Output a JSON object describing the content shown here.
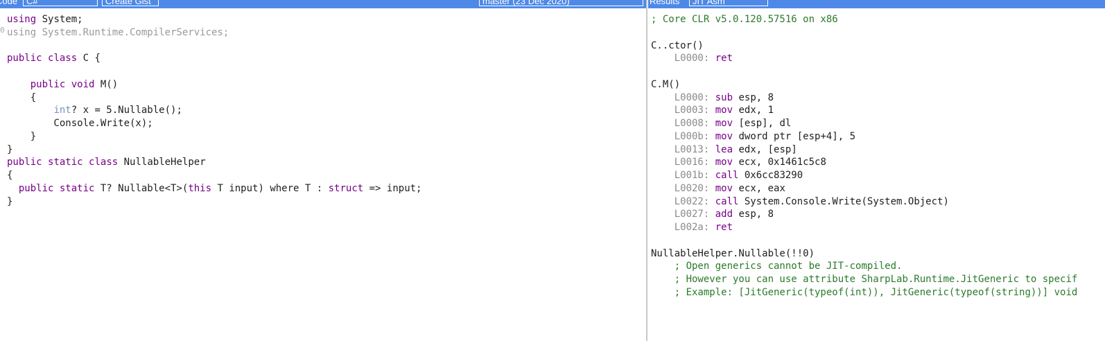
{
  "toolbar": {
    "code_label": "Code",
    "language": "C#",
    "create_gist": "Create Gist",
    "branch": "master (23 Dec 2020)",
    "results_label": "Results",
    "output_mode": "JIT Asm"
  },
  "code": {
    "gutter_mark": "0",
    "lines": [
      [
        [
          "kw",
          "using"
        ],
        [
          "plain",
          " System;"
        ]
      ],
      [
        [
          "faded",
          "using System.Runtime.CompilerServices;"
        ]
      ],
      [],
      [
        [
          "kw",
          "public"
        ],
        [
          "plain",
          " "
        ],
        [
          "kw",
          "class"
        ],
        [
          "plain",
          " C {"
        ]
      ],
      [],
      [
        [
          "plain",
          "    "
        ],
        [
          "kw",
          "public"
        ],
        [
          "plain",
          " "
        ],
        [
          "kw",
          "void"
        ],
        [
          "plain",
          " M()"
        ]
      ],
      [
        [
          "plain",
          "    {"
        ]
      ],
      [
        [
          "plain",
          "        "
        ],
        [
          "type",
          "int"
        ],
        [
          "plain",
          "? x = 5.Nullable();"
        ]
      ],
      [
        [
          "plain",
          "        Console.Write(x);"
        ]
      ],
      [
        [
          "plain",
          "    }"
        ]
      ],
      [
        [
          "plain",
          "}"
        ]
      ],
      [
        [
          "kw",
          "public"
        ],
        [
          "plain",
          " "
        ],
        [
          "kw",
          "static"
        ],
        [
          "plain",
          " "
        ],
        [
          "kw",
          "class"
        ],
        [
          "plain",
          " NullableHelper"
        ]
      ],
      [
        [
          "plain",
          "{"
        ]
      ],
      [
        [
          "plain",
          "  "
        ],
        [
          "kw",
          "public"
        ],
        [
          "plain",
          " "
        ],
        [
          "kw",
          "static"
        ],
        [
          "plain",
          " T? Nullable<T>("
        ],
        [
          "kw",
          "this"
        ],
        [
          "plain",
          " T input) where T : "
        ],
        [
          "kw",
          "struct"
        ],
        [
          "plain",
          " => input;"
        ]
      ],
      [
        [
          "plain",
          "}"
        ]
      ]
    ]
  },
  "result": {
    "lines": [
      [
        [
          "comment",
          "; Core CLR v5.0.120.57516 on x86"
        ]
      ],
      [],
      [
        [
          "plain",
          "C..ctor()"
        ]
      ],
      [
        [
          "plain",
          "    "
        ],
        [
          "addr",
          "L0000:"
        ],
        [
          "plain",
          " "
        ],
        [
          "kw",
          "ret"
        ]
      ],
      [],
      [
        [
          "plain",
          "C.M()"
        ]
      ],
      [
        [
          "plain",
          "    "
        ],
        [
          "addr",
          "L0000:"
        ],
        [
          "plain",
          " "
        ],
        [
          "kw",
          "sub"
        ],
        [
          "plain",
          " esp, 8"
        ]
      ],
      [
        [
          "plain",
          "    "
        ],
        [
          "addr",
          "L0003:"
        ],
        [
          "plain",
          " "
        ],
        [
          "kw",
          "mov"
        ],
        [
          "plain",
          " edx, 1"
        ]
      ],
      [
        [
          "plain",
          "    "
        ],
        [
          "addr",
          "L0008:"
        ],
        [
          "plain",
          " "
        ],
        [
          "kw",
          "mov"
        ],
        [
          "plain",
          " [esp], dl"
        ]
      ],
      [
        [
          "plain",
          "    "
        ],
        [
          "addr",
          "L000b:"
        ],
        [
          "plain",
          " "
        ],
        [
          "kw",
          "mov"
        ],
        [
          "plain",
          " dword ptr [esp+4], 5"
        ]
      ],
      [
        [
          "plain",
          "    "
        ],
        [
          "addr",
          "L0013:"
        ],
        [
          "plain",
          " "
        ],
        [
          "kw",
          "lea"
        ],
        [
          "plain",
          " edx, [esp]"
        ]
      ],
      [
        [
          "plain",
          "    "
        ],
        [
          "addr",
          "L0016:"
        ],
        [
          "plain",
          " "
        ],
        [
          "kw",
          "mov"
        ],
        [
          "plain",
          " ecx, 0x1461c5c8"
        ]
      ],
      [
        [
          "plain",
          "    "
        ],
        [
          "addr",
          "L001b:"
        ],
        [
          "plain",
          " "
        ],
        [
          "kw",
          "call"
        ],
        [
          "plain",
          " 0x6cc83290"
        ]
      ],
      [
        [
          "plain",
          "    "
        ],
        [
          "addr",
          "L0020:"
        ],
        [
          "plain",
          " "
        ],
        [
          "kw",
          "mov"
        ],
        [
          "plain",
          " ecx, eax"
        ]
      ],
      [
        [
          "plain",
          "    "
        ],
        [
          "addr",
          "L0022:"
        ],
        [
          "plain",
          " "
        ],
        [
          "kw",
          "call"
        ],
        [
          "plain",
          " System.Console.Write(System.Object)"
        ]
      ],
      [
        [
          "plain",
          "    "
        ],
        [
          "addr",
          "L0027:"
        ],
        [
          "plain",
          " "
        ],
        [
          "kw",
          "add"
        ],
        [
          "plain",
          " esp, 8"
        ]
      ],
      [
        [
          "plain",
          "    "
        ],
        [
          "addr",
          "L002a:"
        ],
        [
          "plain",
          " "
        ],
        [
          "kw",
          "ret"
        ]
      ],
      [],
      [
        [
          "plain",
          "NullableHelper.Nullable(!!0)"
        ]
      ],
      [
        [
          "plain",
          "    "
        ],
        [
          "comment",
          "; Open generics cannot be JIT-compiled."
        ]
      ],
      [
        [
          "plain",
          "    "
        ],
        [
          "comment",
          "; However you can use attribute SharpLab.Runtime.JitGeneric to specif"
        ]
      ],
      [
        [
          "plain",
          "    "
        ],
        [
          "comment",
          "; Example: [JitGeneric(typeof(int)), JitGeneric(typeof(string))] void"
        ]
      ]
    ]
  }
}
